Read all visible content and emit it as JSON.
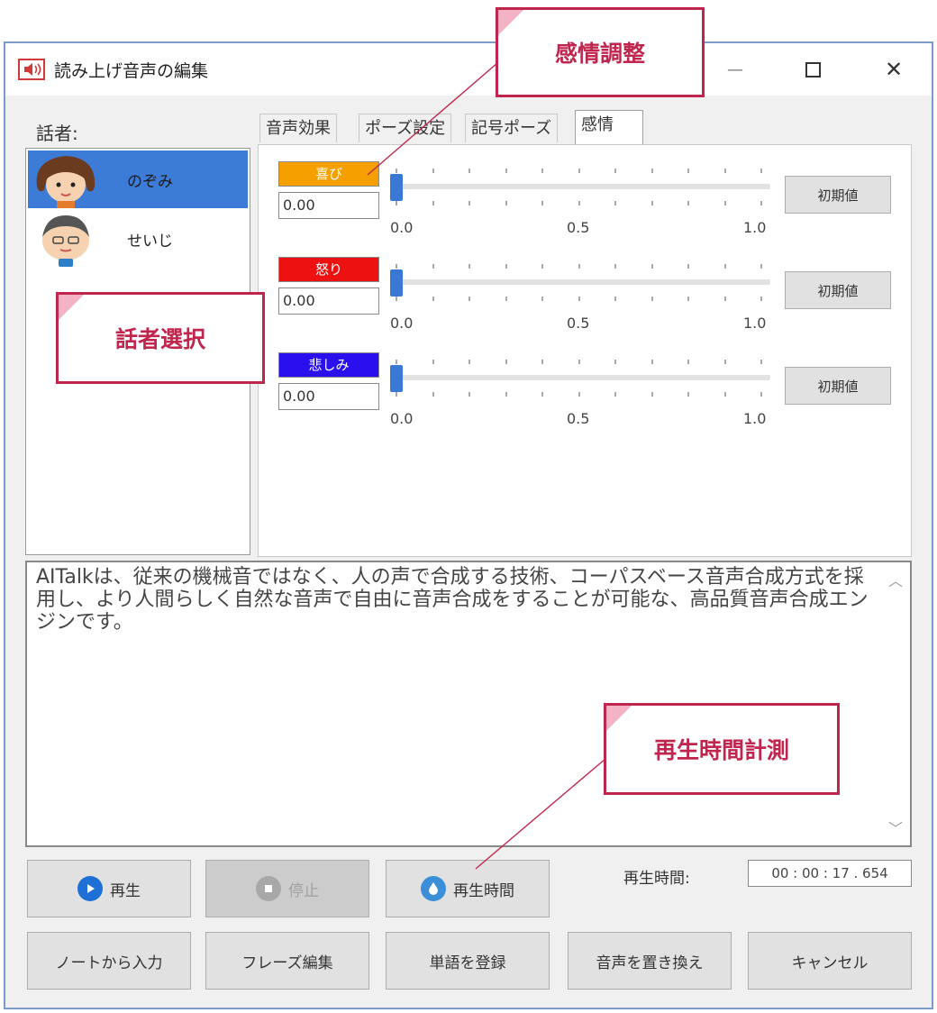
{
  "window": {
    "title": "読み上げ音声の編集",
    "minimize": "—",
    "close": "✕"
  },
  "speakers": {
    "label": "話者:",
    "items": [
      {
        "name": "のぞみ",
        "selected": true
      },
      {
        "name": "せいじ",
        "selected": false
      }
    ]
  },
  "tabs": [
    {
      "label": "音声効果",
      "active": false
    },
    {
      "label": "ポーズ設定",
      "active": false
    },
    {
      "label": "記号ポーズ",
      "active": false
    },
    {
      "label": "感情",
      "active": true
    }
  ],
  "emotions": [
    {
      "label": "喜び",
      "color": "#f5a000",
      "value_text": "0.00",
      "value": 0.0,
      "min_label": "0.0",
      "mid_label": "0.5",
      "max_label": "1.0",
      "reset_label": "初期値"
    },
    {
      "label": "怒り",
      "color": "#ee1111",
      "value_text": "0.00",
      "value": 0.0,
      "min_label": "0.0",
      "mid_label": "0.5",
      "max_label": "1.0",
      "reset_label": "初期値"
    },
    {
      "label": "悲しみ",
      "color": "#2a10ee",
      "value_text": "0.00",
      "value": 0.0,
      "min_label": "0.0",
      "mid_label": "0.5",
      "max_label": "1.0",
      "reset_label": "初期値"
    }
  ],
  "text_input": {
    "value": "AITalkは、従来の機械音ではなく、人の声で合成する技術、コーパスベース音声合成方式を採用し、より人間らしく自然な音声で自由に音声合成をすることが可能な、高品質音声合成エンジンです。"
  },
  "buttons": {
    "play": "再生",
    "stop": "停止",
    "measure": "再生時間",
    "from_note": "ノートから入力",
    "phrase_edit": "フレーズ編集",
    "register_word": "単語を登録",
    "replace_audio": "音声を置き換え",
    "cancel": "キャンセル"
  },
  "playback": {
    "label": "再生時間:",
    "value": "00 : 00 : 17 . 654"
  },
  "callouts": {
    "emotion": "感情調整",
    "speaker": "話者選択",
    "measure": "再生時間計測"
  },
  "colors": {
    "accent": "#c0264d",
    "selection": "#3c7bd6",
    "thumb": "#3a78d6"
  }
}
